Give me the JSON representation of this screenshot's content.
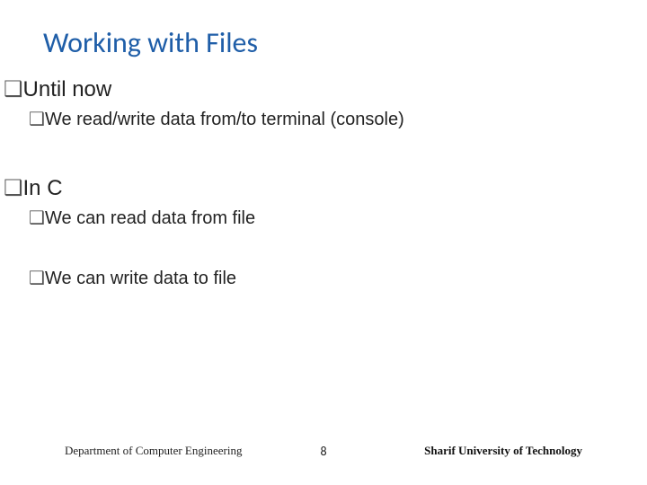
{
  "title": "Working with Files",
  "bullets": {
    "a": {
      "label": "Until now"
    },
    "a1": {
      "label": "We read/write data from/to terminal (console)"
    },
    "b": {
      "label": "In C"
    },
    "b1": {
      "label": "We can read data from file"
    },
    "b2": {
      "label": "We can write data to file"
    }
  },
  "footer": {
    "left": "Department of Computer Engineering",
    "page": "8",
    "right": "Sharif University of Technology"
  }
}
